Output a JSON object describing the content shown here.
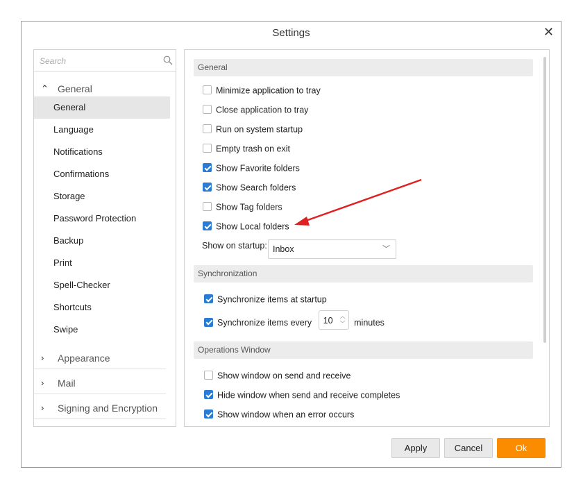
{
  "window": {
    "title": "Settings"
  },
  "search": {
    "placeholder": "Search"
  },
  "sidebar": {
    "general_group": "General",
    "items": [
      "General",
      "Language",
      "Notifications",
      "Confirmations",
      "Storage",
      "Password Protection",
      "Backup",
      "Print",
      "Spell-Checker",
      "Shortcuts",
      "Swipe"
    ],
    "collapsed_groups": [
      "Appearance",
      "Mail",
      "Signing and Encryption"
    ]
  },
  "general": {
    "header": "General",
    "options": [
      {
        "label": "Minimize application to tray",
        "checked": false
      },
      {
        "label": "Close application to tray",
        "checked": false
      },
      {
        "label": "Run on system startup",
        "checked": false
      },
      {
        "label": "Empty trash on exit",
        "checked": false
      },
      {
        "label": "Show Favorite folders",
        "checked": true
      },
      {
        "label": "Show Search folders",
        "checked": true
      },
      {
        "label": "Show Tag folders",
        "checked": false
      },
      {
        "label": "Show Local folders",
        "checked": true
      }
    ],
    "startup_label": "Show on startup:",
    "startup_value": "Inbox"
  },
  "sync": {
    "header": "Synchronization",
    "startup_label": "Synchronize items at startup",
    "startup_checked": true,
    "every_label": "Synchronize items every",
    "every_checked": true,
    "every_value": "10",
    "minutes_label": "minutes"
  },
  "ops": {
    "header": "Operations Window",
    "options": [
      {
        "label": "Show window on send and receive",
        "checked": false
      },
      {
        "label": "Hide window when send and receive completes",
        "checked": true
      },
      {
        "label": "Show window when an error occurs",
        "checked": true
      }
    ]
  },
  "buttons": {
    "apply": "Apply",
    "cancel": "Cancel",
    "ok": "Ok"
  },
  "colors": {
    "ok_button": "#fb8c00",
    "checkbox": "#2a7bd3",
    "arrow": "#e02020"
  }
}
